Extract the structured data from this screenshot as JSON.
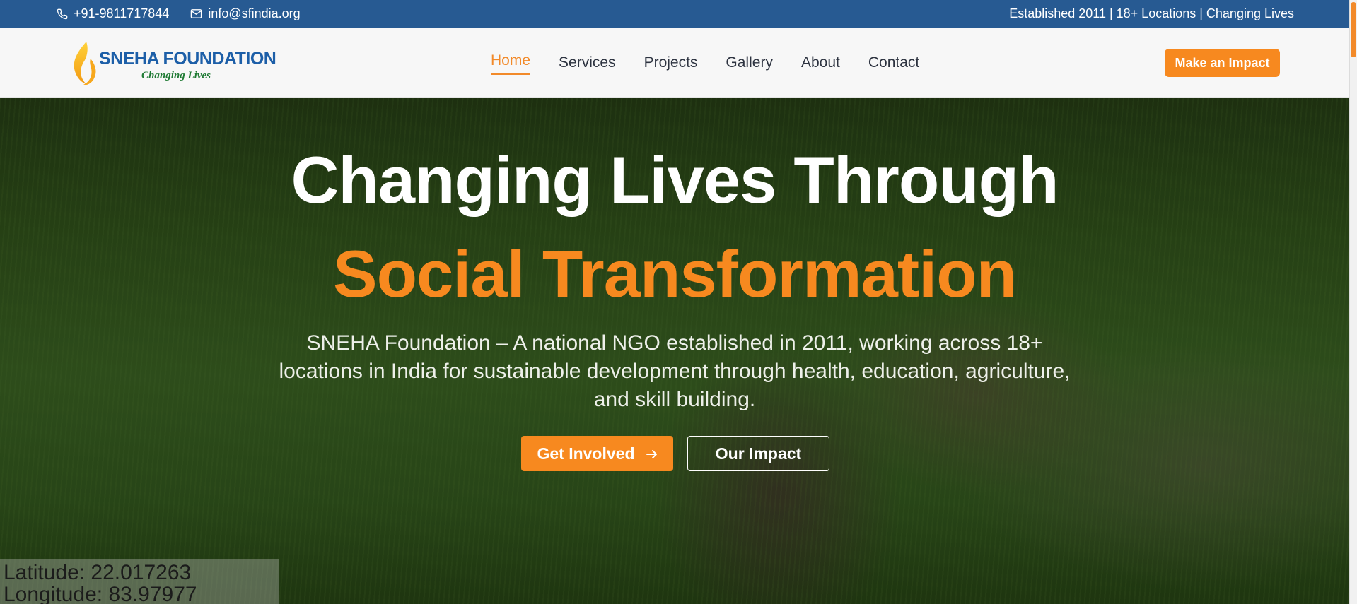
{
  "topbar": {
    "phone": "+91-9811717844",
    "email": "info@sfindia.org",
    "tagline": "Established 2011 | 18+ Locations | Changing Lives",
    "phone_icon": "phone-icon",
    "email_icon": "mail-icon"
  },
  "logo": {
    "name": "SNEHA FOUNDATION",
    "tagline": "Changing Lives",
    "icon": "flame-icon"
  },
  "nav": {
    "items": [
      {
        "label": "Home",
        "active": true
      },
      {
        "label": "Services"
      },
      {
        "label": "Projects"
      },
      {
        "label": "Gallery"
      },
      {
        "label": "About"
      },
      {
        "label": "Contact"
      }
    ],
    "cta": "Make an Impact"
  },
  "hero": {
    "title_line1": "Changing Lives Through",
    "title_line2": "Social Transformation",
    "description": "SNEHA Foundation – A national NGO established in 2011, working across 18+ locations in India for sustainable development through health, education, agriculture, and skill building.",
    "primary_button": "Get Involved",
    "primary_icon": "arrow-right-icon",
    "secondary_button": "Our Impact"
  },
  "overlay": {
    "latitude": "Latitude: 22.017263",
    "longitude": "Longitude: 83.97977"
  },
  "colors": {
    "primary_blue": "#275a92",
    "accent_orange": "#f7891f"
  }
}
